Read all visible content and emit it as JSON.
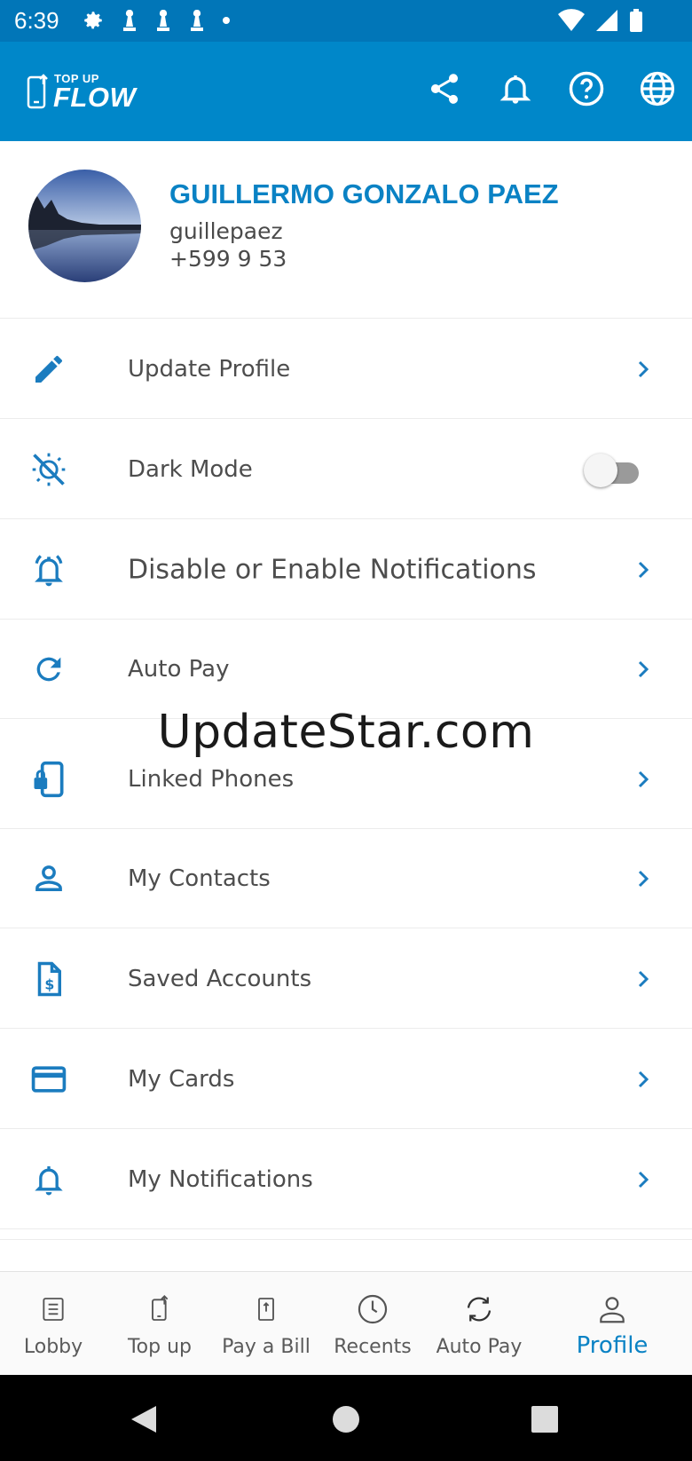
{
  "status_bar": {
    "time": "6:39"
  },
  "header": {
    "logo_top": "TOP UP",
    "logo_main": "FLOW",
    "actions": [
      "share-icon",
      "bell-icon",
      "help-icon",
      "globe-icon"
    ]
  },
  "profile": {
    "name": "GUILLERMO GONZALO PAEZ",
    "username": "guillepaez",
    "phone": "+599 9 53"
  },
  "menu": {
    "update_profile": "Update Profile",
    "dark_mode": "Dark Mode",
    "dark_mode_on": false,
    "notifications_setting": "Disable or Enable Notifications",
    "auto_pay": "Auto Pay",
    "linked_phones": "Linked Phones",
    "my_contacts": "My Contacts",
    "saved_accounts": "Saved Accounts",
    "my_cards": "My Cards",
    "my_notifications": "My Notifications"
  },
  "watermark": "UpdateStar.com",
  "bottom_nav": {
    "lobby": "Lobby",
    "top_up": "Top up",
    "pay_bill": "Pay a Bill",
    "recents": "Recents",
    "auto_pay": "Auto Pay",
    "profile": "Profile",
    "active": "Profile"
  },
  "colors": {
    "header": "#0087c9",
    "status_bar": "#0176b8",
    "accent": "#0a82c4",
    "icon": "#1b7cbf"
  }
}
